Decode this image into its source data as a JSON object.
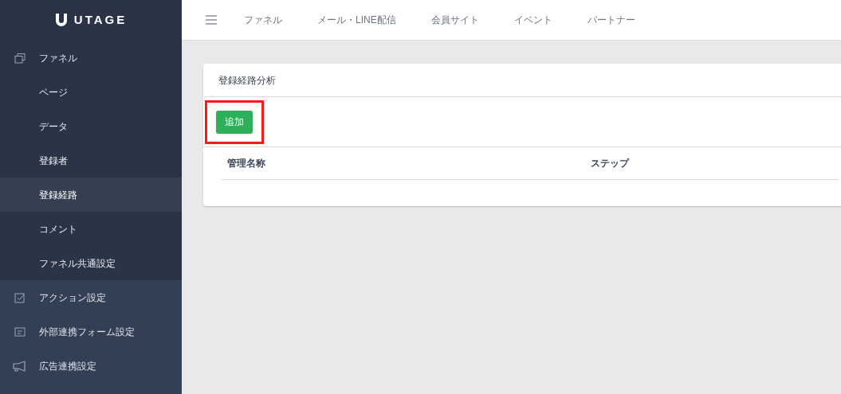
{
  "logo": {
    "text": "UTAGE"
  },
  "sidebar": {
    "items": [
      {
        "label": "ファネル",
        "expanded": true,
        "children": [
          {
            "label": "ページ",
            "selected": false
          },
          {
            "label": "データ",
            "selected": false
          },
          {
            "label": "登録者",
            "selected": false
          },
          {
            "label": "登録経路",
            "selected": true
          },
          {
            "label": "コメント",
            "selected": false
          },
          {
            "label": "ファネル共通設定",
            "selected": false
          }
        ]
      },
      {
        "label": "アクション設定",
        "expanded": false
      },
      {
        "label": "外部連携フォーム設定",
        "expanded": false
      },
      {
        "label": "広告連携設定",
        "expanded": false
      }
    ]
  },
  "topnav": {
    "items": [
      "ファネル",
      "メール・LINE配信",
      "会員サイト",
      "イベント",
      "パートナー"
    ]
  },
  "card": {
    "title": "登録経路分析",
    "add_button": {
      "label": "追加",
      "highlighted": true
    },
    "table": {
      "columns": [
        "管理名称",
        "ステップ"
      ]
    }
  }
}
